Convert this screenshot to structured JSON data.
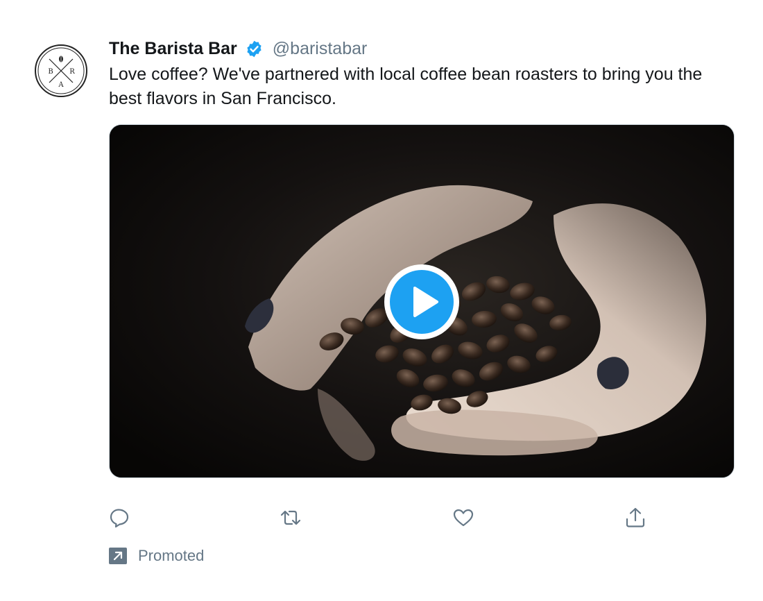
{
  "tweet": {
    "author_name": "The Barista Bar",
    "author_handle": "@baristabar",
    "verified": true,
    "avatar_icon": "barista-bar-logo",
    "avatar_logo_letters": [
      "B",
      "A",
      "R"
    ],
    "text": "Love coffee? We've partnered with local coffee bean roasters to bring you the best flavors in San Francisco.",
    "media": {
      "type": "video",
      "description_icon": "play-icon"
    }
  },
  "actions": [
    {
      "name": "reply",
      "icon": "reply-icon"
    },
    {
      "name": "retweet",
      "icon": "retweet-icon"
    },
    {
      "name": "like",
      "icon": "heart-icon"
    },
    {
      "name": "share",
      "icon": "share-icon"
    }
  ],
  "promoted": {
    "label": "Promoted",
    "icon": "promoted-arrow-icon"
  },
  "colors": {
    "accent": "#1da1f2",
    "text": "#14171a",
    "secondary": "#657786",
    "border": "#ccd6dd"
  }
}
